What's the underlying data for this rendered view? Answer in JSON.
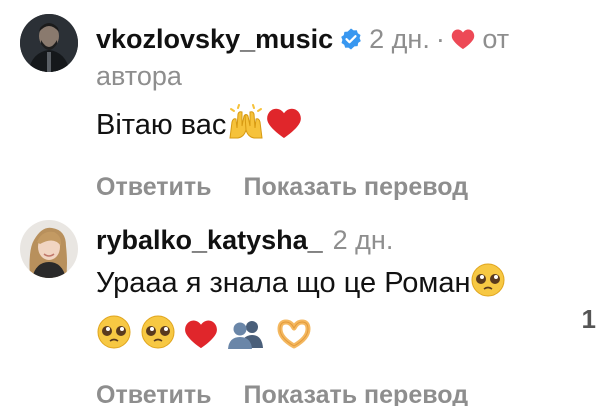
{
  "comments": [
    {
      "username": "vkozlovsky_music",
      "verified": true,
      "time": "2 дн.",
      "separator": "·",
      "author_like_label_1": "от",
      "author_like_label_2": "автора",
      "text": "Вітаю вас",
      "emojis": [
        "raising-hands-emoji",
        "red-heart-emoji"
      ],
      "reply_label": "Ответить",
      "translate_label": "Показать перевод"
    },
    {
      "username": "rybalko_katysha_",
      "time": "2 дн.",
      "text_line1": "Урааа я знала що це Роман",
      "emojis": [
        "pleading-face-emoji",
        "pleading-face-emoji",
        "pleading-face-emoji",
        "red-heart-emoji",
        "busts-in-silhouette-emoji",
        "heart-hands-emoji"
      ],
      "like_count": "1",
      "reply_label": "Ответить",
      "translate_label": "Показать перевод"
    }
  ],
  "colors": {
    "verified": "#3897f0",
    "heart": "#ed4956",
    "secondary_text": "#8e8e8e"
  }
}
